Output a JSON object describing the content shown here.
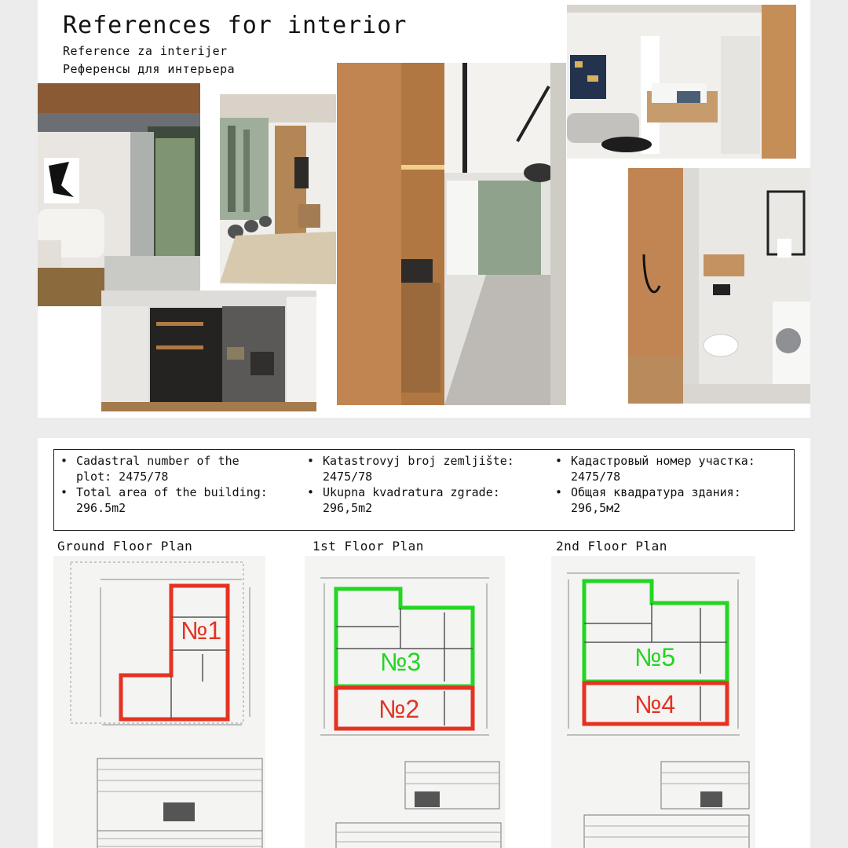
{
  "header": {
    "title": "References for interior",
    "subtitle_sr": "Reference za interijer",
    "subtitle_ru": "Референсы для интерьера"
  },
  "reference_photos": [
    {
      "name": "living-room-glass-wall-photo"
    },
    {
      "name": "lounge-with-forest-view-photo"
    },
    {
      "name": "dark-tv-wall-study-photo"
    },
    {
      "name": "wood-kitchen-corridor-photo"
    },
    {
      "name": "bedroom-with-sofa-photo"
    },
    {
      "name": "bathroom-with-shower-photo"
    }
  ],
  "info": {
    "columns": [
      {
        "lines": [
          "Cadastral number of the\nplot: 2475/78",
          "Total area of the building:\n296.5m2"
        ]
      },
      {
        "lines": [
          "Katastrovyj broj zemljište:\n2475/78",
          "Ukupna kvadratura zgrade:\n296,5m2"
        ]
      },
      {
        "lines": [
          "Кадастровый номер участка:\n2475/78",
          "Общая квадратура здания:\n296,5м2"
        ]
      }
    ]
  },
  "plans": [
    {
      "title": "Ground Floor Plan",
      "units": [
        {
          "label": "№1",
          "color": "#e53222"
        }
      ]
    },
    {
      "title": "1st Floor Plan",
      "units": [
        {
          "label": "№3",
          "color": "#22d622"
        },
        {
          "label": "№2",
          "color": "#e53222"
        }
      ]
    },
    {
      "title": "2nd Floor Plan",
      "units": [
        {
          "label": "№5",
          "color": "#22d622"
        },
        {
          "label": "№4",
          "color": "#e53222"
        }
      ]
    }
  ],
  "colors": {
    "red_unit": "#e53222",
    "green_unit": "#22d622",
    "wood": "#c48a55"
  }
}
